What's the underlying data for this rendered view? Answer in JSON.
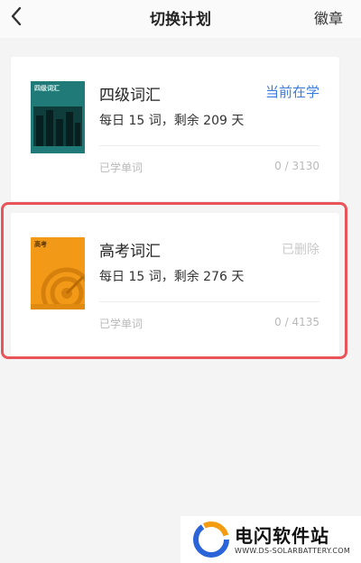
{
  "header": {
    "title": "切换计划",
    "action_label": "徽章"
  },
  "plans": [
    {
      "title": "四级词汇",
      "daily_plan": "每日 15 词，剩余 209 天",
      "status": "当前在学",
      "learned_label": "已学单词",
      "learned_count": "0 / 3130",
      "cover_label": "四级词汇",
      "cover_color": "#1f7a78"
    },
    {
      "title": "高考词汇",
      "daily_plan": "每日 15 词，剩余 276 天",
      "status": "已删除",
      "learned_label": "已学单词",
      "learned_count": "0 / 4135",
      "cover_label": "高考",
      "cover_color": "#f29a18"
    }
  ],
  "highlight_color": "#e8545a",
  "watermark": {
    "title": "电闪软件站",
    "url": "WWW.DS-SOLARBATTERY.COM"
  }
}
